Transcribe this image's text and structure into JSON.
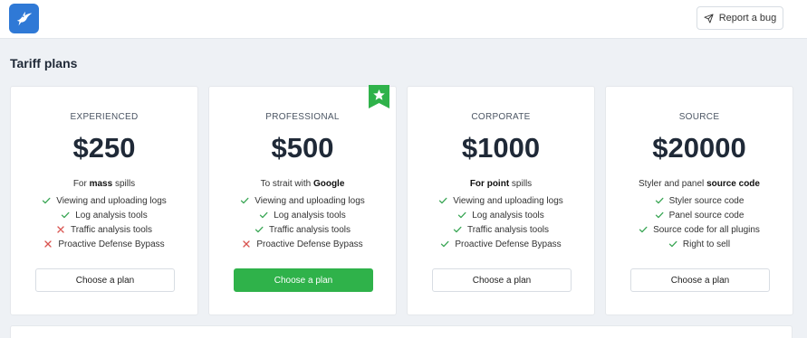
{
  "header": {
    "logo_icon": "hummingbird-icon",
    "report_bug_label": "Report a bug"
  },
  "section_title": "Tariff plans",
  "plans": [
    {
      "tier": "EXPERIENCED",
      "price": "$250",
      "tagline_prefix": "For ",
      "tagline_bold": "mass",
      "tagline_suffix": " spills",
      "features": [
        {
          "label": "Viewing and uploading logs",
          "included": true
        },
        {
          "label": "Log analysis tools",
          "included": true
        },
        {
          "label": "Traffic analysis tools",
          "included": false
        },
        {
          "label": "Proactive Defense Bypass",
          "included": false
        }
      ],
      "button": "Choose a plan"
    },
    {
      "tier": "PROFESSIONAL",
      "price": "$500",
      "tagline_prefix": "To strait with ",
      "tagline_bold": "Google",
      "tagline_suffix": "",
      "features": [
        {
          "label": "Viewing and uploading logs",
          "included": true
        },
        {
          "label": "Log analysis tools",
          "included": true
        },
        {
          "label": "Traffic analysis tools",
          "included": true
        },
        {
          "label": "Proactive Defense Bypass",
          "included": false
        }
      ],
      "button": "Choose a plan",
      "featured_icon": "star-icon"
    },
    {
      "tier": "CORPORATE",
      "price": "$1000",
      "tagline_prefix": "",
      "tagline_bold": "For point",
      "tagline_suffix": " spills",
      "features": [
        {
          "label": "Viewing and uploading logs",
          "included": true
        },
        {
          "label": "Log analysis tools",
          "included": true
        },
        {
          "label": "Traffic analysis tools",
          "included": true
        },
        {
          "label": "Proactive Defense Bypass",
          "included": true
        }
      ],
      "button": "Choose a plan"
    },
    {
      "tier": "SOURCE",
      "price": "$20000",
      "tagline_prefix": "Styler and panel ",
      "tagline_bold": "source code",
      "tagline_suffix": "",
      "features": [
        {
          "label": "Styler source code",
          "included": true
        },
        {
          "label": "Panel source code",
          "included": true
        },
        {
          "label": "Source code for all plugins",
          "included": true
        },
        {
          "label": "Right to sell",
          "included": true
        }
      ],
      "button": "Choose a plan"
    }
  ],
  "colors": {
    "accent": "#2fb24a",
    "check": "#3aa655",
    "cross": "#d9534f",
    "logo_bg": "#2f79d6"
  }
}
